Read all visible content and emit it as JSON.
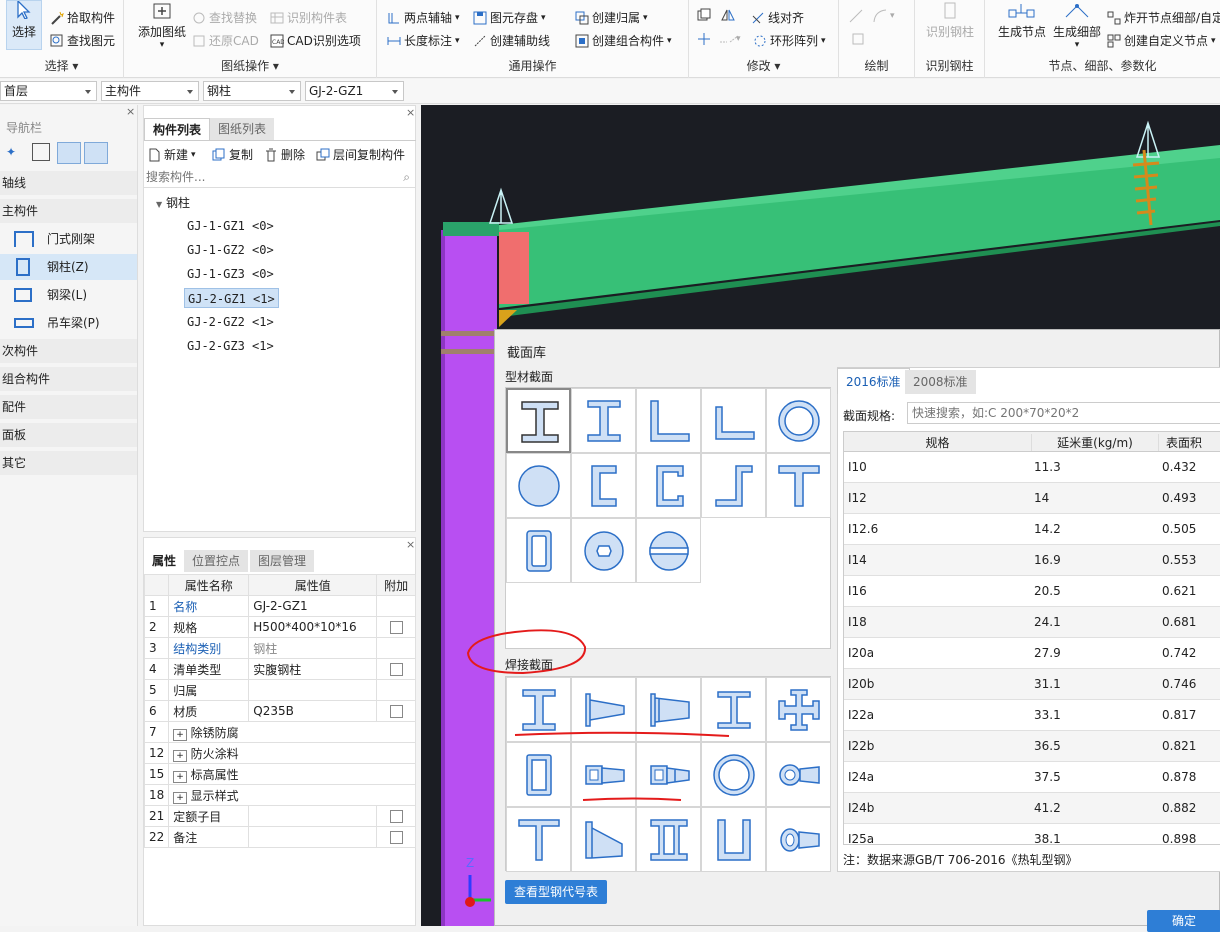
{
  "ribbon": {
    "select": {
      "big": "选择",
      "pick": "拾取构件",
      "find_elem": "查找图元",
      "title": "选择"
    },
    "drawing_ops": {
      "add": "添加图纸",
      "find_replace": "查找替换",
      "restore_cad": "还原CAD",
      "recognize_table": "识别构件表",
      "cad_options": "CAD识别选项",
      "title": "图纸操作"
    },
    "general_ops": {
      "two_point_aux": "两点辅轴",
      "elem_save": "图元存盘",
      "create_group": "创建归属",
      "length_dim": "长度标注",
      "create_aux_line": "创建辅助线",
      "create_combo": "创建组合构件",
      "title": "通用操作"
    },
    "modify": {
      "line_align": "线对齐",
      "ring_array": "环形阵列",
      "title": "修改"
    },
    "draw": {
      "title": "绘制"
    },
    "recognize_col": {
      "btn": "识别钢柱",
      "title": "识别钢柱"
    },
    "nodes": {
      "gen_node": "生成节点",
      "gen_detail": "生成细部",
      "explode": "炸开节点细部/自定",
      "create_custom": "创建自定义节点",
      "title": "节点、细部、参数化"
    }
  },
  "toolbar2": {
    "floor": "首层",
    "type": "主构件",
    "sub": "钢柱",
    "item": "GJ-2-GZ1"
  },
  "nav": {
    "title": "导航栏",
    "cats": [
      "轴线",
      "主构件",
      "次构件",
      "组合构件",
      "配件",
      "面板",
      "其它"
    ],
    "items": [
      "门式刚架",
      "钢柱(Z)",
      "钢梁(L)",
      "吊车梁(P)"
    ]
  },
  "complist": {
    "tabs": [
      "构件列表",
      "图纸列表"
    ],
    "new": "新建",
    "copy": "复制",
    "delete": "删除",
    "floor_copy": "层间复制构件",
    "search_placeholder": "搜索构件...",
    "root": "钢柱",
    "items": [
      "GJ-1-GZ1 <0>",
      "GJ-1-GZ2 <0>",
      "GJ-1-GZ3 <0>",
      "GJ-2-GZ1 <1>",
      "GJ-2-GZ2 <1>",
      "GJ-2-GZ3 <1>"
    ]
  },
  "props": {
    "tabs": [
      "属性",
      "位置控点",
      "图层管理"
    ],
    "headers": [
      "属性名称",
      "属性值",
      "附加"
    ],
    "rows": [
      {
        "n": "1",
        "name": "名称",
        "val": "GJ-2-GZ1"
      },
      {
        "n": "2",
        "name": "规格",
        "val": "H500*400*10*16"
      },
      {
        "n": "3",
        "name": "结构类别",
        "val": "钢柱"
      },
      {
        "n": "4",
        "name": "清单类型",
        "val": "实腹钢柱"
      },
      {
        "n": "5",
        "name": "归属",
        "val": ""
      },
      {
        "n": "6",
        "name": "材质",
        "val": "Q235B"
      },
      {
        "n": "7",
        "name": "除锈防腐",
        "val": ""
      },
      {
        "n": "12",
        "name": "防火涂料",
        "val": ""
      },
      {
        "n": "15",
        "name": "标高属性",
        "val": ""
      },
      {
        "n": "18",
        "name": "显示样式",
        "val": ""
      },
      {
        "n": "21",
        "name": "定额子目",
        "val": ""
      },
      {
        "n": "22",
        "name": "备注",
        "val": ""
      }
    ]
  },
  "dialog": {
    "title": "截面库",
    "profile_label": "型材截面",
    "welded_label": "焊接截面",
    "tabs": [
      "2016标准",
      "2008标准"
    ],
    "spec_label": "截面规格:",
    "spec_placeholder": "快速搜索，如:C 200*70*20*2",
    "headers": [
      "规格",
      "延米重(kg/m)",
      "表面积"
    ],
    "rows": [
      [
        "I10",
        "11.3",
        "0.432"
      ],
      [
        "I12",
        "14",
        "0.493"
      ],
      [
        "I12.6",
        "14.2",
        "0.505"
      ],
      [
        "I14",
        "16.9",
        "0.553"
      ],
      [
        "I16",
        "20.5",
        "0.621"
      ],
      [
        "I18",
        "24.1",
        "0.681"
      ],
      [
        "I20a",
        "27.9",
        "0.742"
      ],
      [
        "I20b",
        "31.1",
        "0.746"
      ],
      [
        "I22a",
        "33.1",
        "0.817"
      ],
      [
        "I22b",
        "36.5",
        "0.821"
      ],
      [
        "I24a",
        "37.5",
        "0.878"
      ],
      [
        "I24b",
        "41.2",
        "0.882"
      ],
      [
        "I25a",
        "38.1",
        "0.898"
      ]
    ],
    "note": "注：数据来源GB/T 706-2016《热轧型钢》",
    "view_btn": "查看型钢代号表",
    "ok_btn": "确定"
  },
  "axis": {
    "z": "Z"
  }
}
